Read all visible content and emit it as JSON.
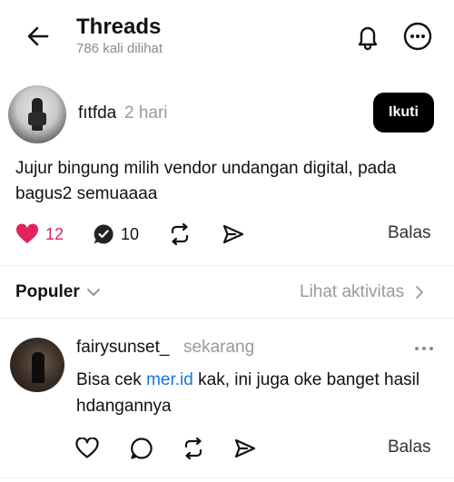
{
  "header": {
    "title": "Threads",
    "views": "786 kali dilihat",
    "icons": [
      "back-arrow-icon",
      "bell-icon",
      "more-icon"
    ]
  },
  "post": {
    "username": "fıtfda",
    "time": "2 hari",
    "follow_label": "Ikuti",
    "text": "Jujur bingung milih vendor undangan digital, pada bagus2 semuaaaa",
    "likes": "12",
    "comments": "10",
    "reply_label": "Balas",
    "like_color": "#e0245e"
  },
  "filter": {
    "sort_label": "Populer",
    "activity_label": "Lihat aktivitas"
  },
  "comment": {
    "username": "fairysunset_",
    "time": "sekarang",
    "text_before": "Bisa cek ",
    "link": "mer.id",
    "text_after": " kak, ini juga oke banget hasil hdangannya",
    "reply_label": "Balas",
    "link_color": "#1877d6"
  }
}
